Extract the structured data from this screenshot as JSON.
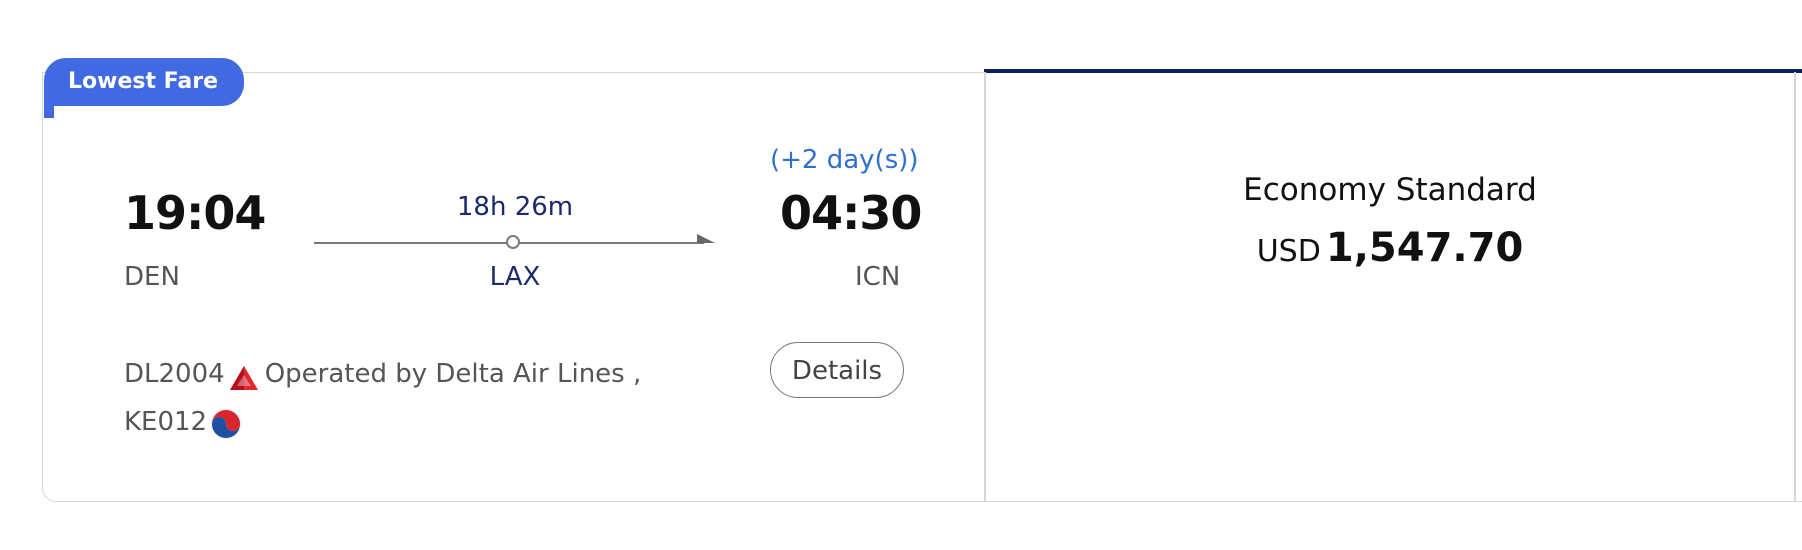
{
  "badge": {
    "label": "Lowest Fare"
  },
  "itinerary": {
    "departure": {
      "time": "19:04",
      "airport": "DEN"
    },
    "arrival": {
      "time": "04:30",
      "airport": "ICN",
      "day_offset": "(+2 day(s))"
    },
    "duration": "18h 26m",
    "stopover": "LAX",
    "flights": [
      {
        "number": "DL2004",
        "operated_by": "Operated by Delta Air Lines ,",
        "icon": "delta-logo-icon"
      },
      {
        "number": "KE012",
        "icon": "korean-air-logo-icon"
      }
    ],
    "details_label": "Details"
  },
  "fare": {
    "name": "Economy Standard",
    "currency": "USD",
    "amount": "1,547.70"
  },
  "colors": {
    "badge": "#4169e1",
    "fare_top_border": "#0b1f5c",
    "day_offset": "#2f6fd0",
    "route_text": "#1a2a6c"
  }
}
